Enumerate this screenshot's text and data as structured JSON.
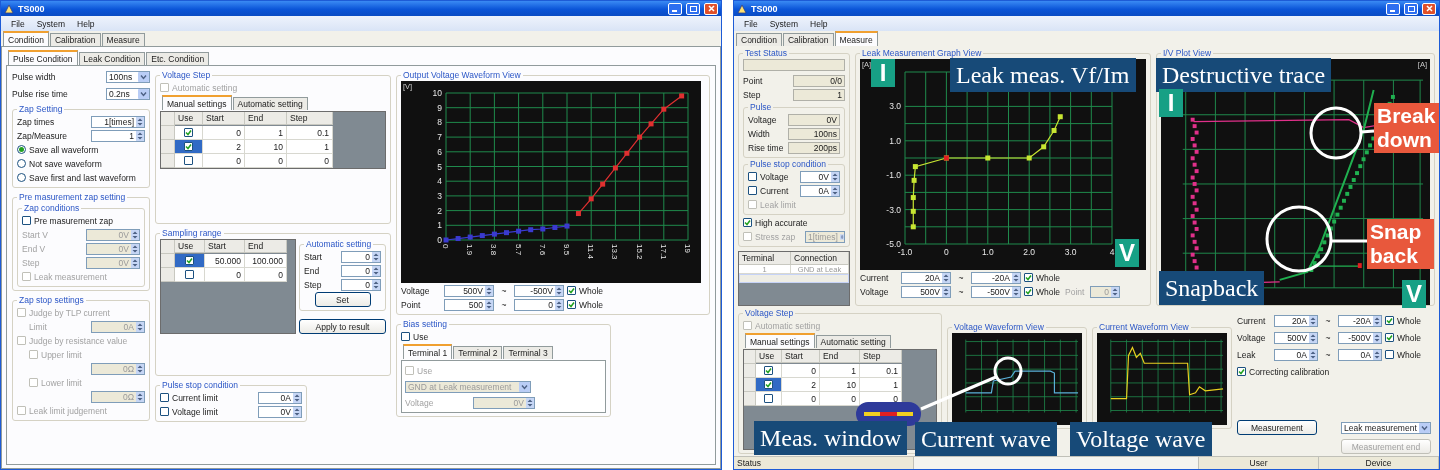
{
  "left_window": {
    "title": "TS000",
    "menu": [
      "File",
      "System",
      "Help"
    ],
    "tabs": [
      {
        "label": "Condition",
        "selected": true
      },
      {
        "label": "Calibration",
        "selected": false
      },
      {
        "label": "Measure",
        "selected": false
      }
    ],
    "subtabs": [
      {
        "label": "Pulse Condition",
        "selected": true
      },
      {
        "label": "Leak Condition",
        "selected": false
      },
      {
        "label": "Etc. Condition",
        "selected": false
      }
    ],
    "column_1": [
      {
        "kind": "dropdown",
        "label": "Pulse width",
        "value": "100ns",
        "disabled": false
      },
      {
        "kind": "dropdown",
        "label": "Pulse rise time",
        "value": "0.2ns",
        "disabled": false
      },
      {
        "kind": "group",
        "title": "Zap Setting",
        "controls": [
          {
            "kind": "spin",
            "label": "Zap times",
            "value": "1[times]",
            "disabled": false
          },
          {
            "kind": "spin",
            "label": "Zap/Measure",
            "value": "1",
            "disabled": false
          },
          {
            "kind": "radio",
            "label": "Save all waveform",
            "selected": true
          },
          {
            "kind": "radio",
            "label": "Not save waveform",
            "selected": false
          },
          {
            "kind": "radio",
            "label": "Save first and last waveform",
            "selected": false
          }
        ]
      },
      {
        "kind": "group",
        "title": "Pre masurement zap setting",
        "controls": [
          {
            "kind": "group",
            "title": "Zap conditions",
            "controls": [
              {
                "kind": "check",
                "label": "Pre masurement zap",
                "checked": false,
                "disabled": false
              },
              {
                "kind": "spin",
                "label": "Start V",
                "value": "0V",
                "disabled": true
              },
              {
                "kind": "spin",
                "label": "End V",
                "value": "0V",
                "disabled": true
              },
              {
                "kind": "spin",
                "label": "Step",
                "value": "0V",
                "disabled": true
              },
              {
                "kind": "check",
                "label": "Leak measurement",
                "checked": false,
                "disabled": true
              }
            ]
          }
        ]
      },
      {
        "kind": "group",
        "title": "Zap stop settings",
        "controls": [
          {
            "kind": "check",
            "label": "Judge by TLP current",
            "checked": false,
            "disabled": true,
            "children": [
              {
                "kind": "spin",
                "label": "Limit",
                "value": "0A",
                "disabled": true
              }
            ]
          },
          {
            "kind": "check",
            "label": "Judge by resistance value",
            "checked": false,
            "disabled": true,
            "children": [
              {
                "kind": "check",
                "label": "Upper limit",
                "checked": false,
                "disabled": true
              },
              {
                "kind": "spin",
                "value": "0Ω",
                "disabled": true
              },
              {
                "kind": "check",
                "label": "Lower limit",
                "checked": false,
                "disabled": true
              },
              {
                "kind": "spin",
                "value": "0Ω",
                "disabled": true
              }
            ]
          },
          {
            "kind": "check",
            "label": "Leak limit judgement",
            "checked": false,
            "disabled": true
          }
        ]
      }
    ],
    "voltage_step": {
      "title": "Voltage Step",
      "auto": {
        "label": "Automatic setting",
        "checked": false,
        "disabled": true
      },
      "tabs": [
        {
          "label": "Manual settings",
          "selected": true
        },
        {
          "label": "Automatic setting",
          "selected": false
        }
      ],
      "table": {
        "columns": [
          "Use",
          "Start",
          "End",
          "Step"
        ],
        "rows": [
          {
            "use": true,
            "selected": false,
            "cells": [
              "0",
              "1",
              "0.1"
            ]
          },
          {
            "use": true,
            "selected": true,
            "cells": [
              "2",
              "10",
              "1"
            ]
          },
          {
            "use": false,
            "selected": false,
            "cells": [
              "0",
              "0",
              "0"
            ]
          }
        ]
      }
    },
    "sampling_range": {
      "title": "Sampling range",
      "table": {
        "columns": [
          "Use",
          "Start",
          "End"
        ],
        "rows": [
          {
            "use": true,
            "selected": true,
            "cells": [
              "50.000",
              "100.000"
            ]
          },
          {
            "use": false,
            "selected": false,
            "cells": [
              "0",
              "0"
            ]
          }
        ]
      },
      "auto_setting": {
        "title": "Automatic setting",
        "controls": [
          {
            "kind": "spin",
            "label": "Start",
            "value": "0",
            "disabled": false
          },
          {
            "kind": "spin",
            "label": "End",
            "value": "0",
            "disabled": false
          },
          {
            "kind": "spin",
            "label": "Step",
            "value": "0",
            "disabled": false
          },
          {
            "kind": "button",
            "label": "Set"
          }
        ]
      },
      "apply_button": "Apply to result"
    },
    "pulse_stop": {
      "title": "Pulse stop condition",
      "controls": [
        {
          "kind": "check",
          "label": "Current limit",
          "checked": false,
          "disabled": false,
          "value": "0A"
        },
        {
          "kind": "check",
          "label": "Voltage limit",
          "checked": false,
          "disabled": false,
          "value": "0V"
        }
      ]
    },
    "output_view": {
      "title": "Output Voltage Waveform View",
      "unit": "[V]",
      "chart_data": {
        "type": "line",
        "x": [
          0,
          0.95,
          1.9,
          2.85,
          3.8,
          4.75,
          5.7,
          6.65,
          7.6,
          8.55,
          9.5,
          10.4,
          11.4,
          12.3,
          13.3,
          14.2,
          15.2,
          16.1,
          17.1,
          18.5
        ],
        "series": [
          {
            "color": "#3a3ad0",
            "marker": "square",
            "values": [
              0,
              0.1,
              0.2,
              0.3,
              0.4,
              0.5,
              0.6,
              0.7,
              0.75,
              0.85,
              0.95,
              null,
              null,
              null,
              null,
              null,
              null,
              null,
              null,
              null
            ]
          },
          {
            "color": "#e03030",
            "marker": "square",
            "values": [
              null,
              null,
              null,
              null,
              null,
              null,
              null,
              null,
              null,
              null,
              null,
              1.8,
              2.8,
              3.8,
              4.9,
              5.9,
              7,
              7.9,
              8.9,
              9.8
            ]
          }
        ],
        "xlim": [
          0,
          19
        ],
        "ylim": [
          0,
          10
        ],
        "grid": true,
        "xticks": [
          0,
          1.9,
          3.8,
          5.7,
          7.6,
          9.5,
          11.4,
          13.3,
          15.2,
          17.1,
          19
        ],
        "yticks": [
          0,
          1,
          2,
          3,
          4,
          5,
          6,
          7,
          8,
          9,
          10
        ]
      },
      "ranges": [
        {
          "label": "Voltage",
          "from": "500V",
          "sep": "~",
          "to": "-500V",
          "whole": {
            "label": "Whole",
            "checked": true
          }
        },
        {
          "label": "Point",
          "from": "500",
          "sep": "~",
          "to": "0",
          "whole": {
            "label": "Whole",
            "checked": true
          }
        }
      ]
    },
    "bias": {
      "title": "Bias setting",
      "use": {
        "label": "Use",
        "checked": false
      },
      "tabs": [
        {
          "label": "Terminal 1",
          "selected": true
        },
        {
          "label": "Terminal 2",
          "selected": false
        },
        {
          "label": "Terminal 3",
          "selected": false
        }
      ],
      "controls": [
        {
          "kind": "check",
          "label": "Use",
          "checked": false,
          "disabled": true
        },
        {
          "kind": "dropdown",
          "value": "GND at Leak measurement",
          "disabled": true
        },
        {
          "kind": "spin",
          "label": "Voltage",
          "value": "0V",
          "disabled": true
        }
      ]
    }
  },
  "right_window": {
    "title": "TS000",
    "menu": [
      "File",
      "System",
      "Help"
    ],
    "tabs": [
      {
        "label": "Condition",
        "selected": false
      },
      {
        "label": "Calibration",
        "selected": false
      },
      {
        "label": "Measure",
        "selected": true
      }
    ],
    "test_status": {
      "title": "Test Status",
      "controls": [
        {
          "kind": "readout",
          "label": "Point",
          "value": "0/0"
        },
        {
          "kind": "readout",
          "label": "Step",
          "value": "1"
        },
        {
          "kind": "group",
          "title": "Pulse",
          "controls": [
            {
              "kind": "readout",
              "label": "Voltage",
              "value": "0V"
            },
            {
              "kind": "readout",
              "label": "Width",
              "value": "100ns"
            },
            {
              "kind": "readout",
              "label": "Rise time",
              "value": "200ps"
            }
          ]
        },
        {
          "kind": "group",
          "title": "Pulse stop condition",
          "controls": [
            {
              "kind": "check",
              "label": "Voltage",
              "checked": false,
              "disabled": false,
              "value": "0V"
            },
            {
              "kind": "check",
              "label": "Current",
              "checked": false,
              "disabled": false,
              "value": "0A"
            },
            {
              "kind": "check",
              "label": "Leak limit",
              "checked": false,
              "disabled": true
            }
          ]
        },
        {
          "kind": "check",
          "label": "High accurate",
          "checked": true,
          "disabled": false
        },
        {
          "kind": "check",
          "label": "Stress zap",
          "checked": false,
          "disabled": true,
          "value": "1[times]"
        }
      ]
    },
    "terminal_table": {
      "columns": [
        "Terminal",
        "Connection"
      ],
      "rows": [
        {
          "cells": [
            "1",
            "GND at Leak"
          ]
        }
      ]
    },
    "leak_view": {
      "title": "Leak Measurement Graph View",
      "unit": "[A]",
      "chart_data": {
        "type": "line",
        "x": [
          -0.8,
          -0.8,
          -0.8,
          -0.78,
          -0.75,
          0,
          1,
          2,
          2.35,
          2.6,
          2.75
        ],
        "series": [
          {
            "color": "#c8e632",
            "marker": "square",
            "values": [
              -4,
              -3.1,
              -2.3,
              -1.3,
              -0.5,
              0,
              0,
              0,
              0.65,
              1.6,
              2.4
            ]
          },
          {
            "color": "#e02020",
            "marker": "square",
            "values": [
              null,
              null,
              null,
              null,
              null,
              0,
              null,
              null,
              null,
              null,
              null
            ]
          }
        ],
        "xlim": [
          -1,
          4
        ],
        "ylim": [
          -5,
          5
        ],
        "grid": true,
        "xticks": [
          {
            "value": -1,
            "label": "-1.0"
          },
          0,
          {
            "value": 1,
            "label": "1.0"
          },
          {
            "value": 2,
            "label": "2.0"
          },
          {
            "value": 3,
            "label": "3.0"
          },
          4
        ],
        "yticks": [
          {
            "value": 3,
            "label": "3.0"
          },
          {
            "value": 1,
            "label": "1.0"
          },
          {
            "value": -1,
            "label": "-1.0"
          },
          {
            "value": -3,
            "label": "-3.0"
          },
          {
            "value": -5,
            "label": "-5.0"
          }
        ]
      },
      "ranges": [
        {
          "label": "Current",
          "from": "20A",
          "sep": "~",
          "to": "-20A",
          "whole": {
            "label": "Whole",
            "checked": true
          }
        },
        {
          "label": "Voltage",
          "from": "500V",
          "sep": "~",
          "to": "-500V",
          "whole": {
            "label": "Whole",
            "checked": true
          }
        }
      ],
      "point": {
        "label": "Point",
        "value": "0",
        "disabled": true
      }
    },
    "iv_view": {
      "title": "I/V Plot View",
      "unit": "[A]",
      "ranges": [
        {
          "label": "Current",
          "from": "20A",
          "sep": "~",
          "to": "-20A",
          "whole": {
            "label": "Whole",
            "checked": true
          }
        },
        {
          "label": "Voltage",
          "from": "500V",
          "sep": "~",
          "to": "-500V",
          "whole": {
            "label": "Whole",
            "checked": true
          }
        },
        {
          "label": "Leak",
          "from": "0A",
          "sep": "~",
          "to": "0A",
          "whole": {
            "label": "Whole",
            "checked": false
          }
        }
      ],
      "correcting": {
        "label": "Correcting calibration",
        "checked": true
      },
      "measure_button": "Measurement",
      "mode": "Leak measurement",
      "end_button": {
        "label": "Measurement end",
        "disabled": true
      }
    },
    "voltage_step": {
      "title": "Voltage Step",
      "auto": {
        "label": "Automatic setting",
        "checked": false,
        "disabled": true
      },
      "tabs": [
        {
          "label": "Manual settings",
          "selected": true
        },
        {
          "label": "Automatic setting",
          "selected": false
        }
      ],
      "table": {
        "columns": [
          "Use",
          "Start",
          "End",
          "Step"
        ],
        "rows": [
          {
            "use": true,
            "selected": false,
            "cells": [
              "0",
              "1",
              "0.1"
            ]
          },
          {
            "use": true,
            "selected": true,
            "cells": [
              "2",
              "10",
              "1"
            ]
          },
          {
            "use": false,
            "selected": false,
            "cells": [
              "0",
              "0",
              "0"
            ]
          }
        ]
      }
    },
    "voltage_waveform": {
      "title": "Voltage Waveform View"
    },
    "current_waveform": {
      "title": "Current Waveform View"
    },
    "status_bar": [
      "Status",
      "User",
      "Device"
    ],
    "annotations": [
      {
        "kind": "marker",
        "text": "I"
      },
      {
        "kind": "caption",
        "text": "Leak meas. Vf/Im"
      },
      {
        "kind": "caption",
        "text": "Destructive trace"
      },
      {
        "kind": "marker",
        "text": "I"
      },
      {
        "kind": "callout",
        "text": "Break down"
      },
      {
        "kind": "callout",
        "text": "Snap back"
      },
      {
        "kind": "marker",
        "text": "V"
      },
      {
        "kind": "caption",
        "text": "Snapback"
      },
      {
        "kind": "marker",
        "text": "V"
      },
      {
        "kind": "caption",
        "text": "Meas. window"
      },
      {
        "kind": "caption",
        "text": "Current wave"
      },
      {
        "kind": "caption",
        "text": "Voltage wave"
      }
    ]
  }
}
